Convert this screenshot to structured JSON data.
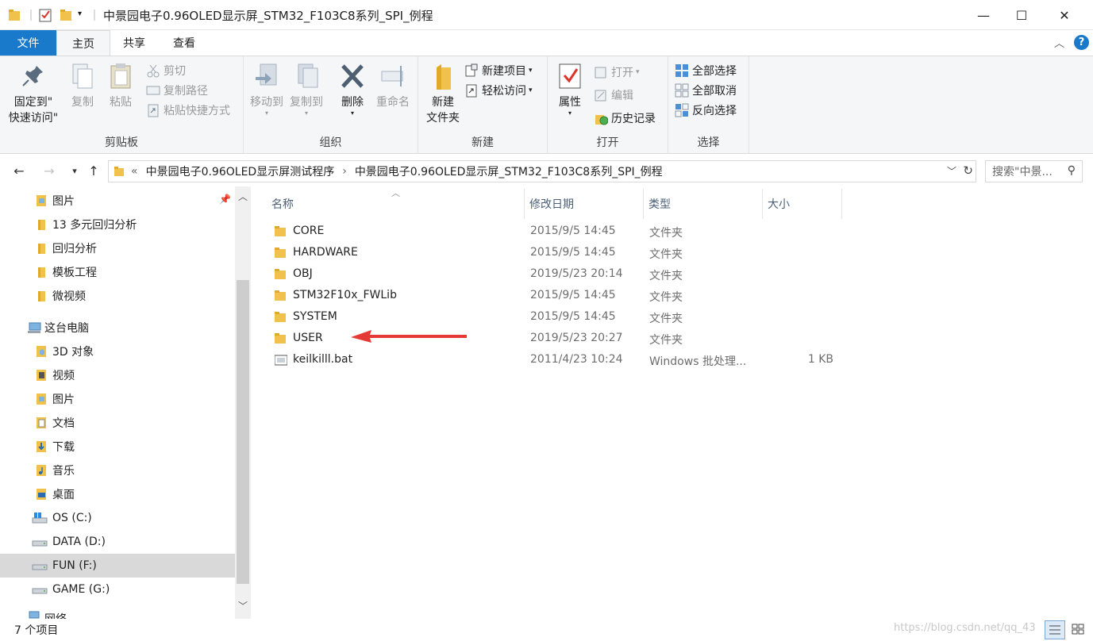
{
  "window": {
    "title": "中景园电子0.96OLED显示屏_STM32_F103C8系列_SPI_例程",
    "minimize": "—",
    "maximize": "☐",
    "close": "✕"
  },
  "ribbon_tabs": {
    "file": "文件",
    "home": "主页",
    "share": "共享",
    "view": "查看"
  },
  "ribbon": {
    "clipboard": {
      "label": "剪贴板",
      "pin_line1": "固定到\"",
      "pin_line2": "快速访问\"",
      "copy": "复制",
      "paste": "粘贴",
      "cut": "剪切",
      "copy_path": "复制路径",
      "paste_shortcut": "粘贴快捷方式"
    },
    "organize": {
      "label": "组织",
      "move_to": "移动到",
      "copy_to": "复制到",
      "delete": "删除",
      "rename": "重命名"
    },
    "new": {
      "label": "新建",
      "new_folder_line1": "新建",
      "new_folder_line2": "文件夹",
      "new_item": "新建项目",
      "easy_access": "轻松访问"
    },
    "open": {
      "label": "打开",
      "properties": "属性",
      "open": "打开",
      "edit": "编辑",
      "history": "历史记录"
    },
    "select": {
      "label": "选择",
      "select_all": "全部选择",
      "select_none": "全部取消",
      "invert": "反向选择"
    }
  },
  "address": {
    "prefix": "«",
    "segment1": "中景园电子0.96OLED显示屏测试程序",
    "separator": "›",
    "segment2": "中景园电子0.96OLED显示屏_STM32_F103C8系列_SPI_例程",
    "search_placeholder": "搜索\"中景..."
  },
  "nav_pane": {
    "items": [
      {
        "label": "图片",
        "pinned": true
      },
      {
        "label": "13 多元回归分析"
      },
      {
        "label": "回归分析"
      },
      {
        "label": "模板工程"
      },
      {
        "label": "微视频"
      },
      {
        "label": "这台电脑"
      },
      {
        "label": "3D 对象"
      },
      {
        "label": "视频"
      },
      {
        "label": "图片"
      },
      {
        "label": "文档"
      },
      {
        "label": "下载"
      },
      {
        "label": "音乐"
      },
      {
        "label": "桌面"
      },
      {
        "label": "OS (C:)"
      },
      {
        "label": "DATA (D:)"
      },
      {
        "label": "FUN (F:)",
        "selected": true
      },
      {
        "label": "GAME (G:)"
      },
      {
        "label": "网络"
      }
    ]
  },
  "columns": {
    "name": "名称",
    "date": "修改日期",
    "type": "类型",
    "size": "大小"
  },
  "files": [
    {
      "name": "CORE",
      "date": "2015/9/5 14:45",
      "type": "文件夹",
      "size": ""
    },
    {
      "name": "HARDWARE",
      "date": "2015/9/5 14:45",
      "type": "文件夹",
      "size": ""
    },
    {
      "name": "OBJ",
      "date": "2019/5/23 20:14",
      "type": "文件夹",
      "size": ""
    },
    {
      "name": "STM32F10x_FWLib",
      "date": "2015/9/5 14:45",
      "type": "文件夹",
      "size": ""
    },
    {
      "name": "SYSTEM",
      "date": "2015/9/5 14:45",
      "type": "文件夹",
      "size": ""
    },
    {
      "name": "USER",
      "date": "2019/5/23 20:27",
      "type": "文件夹",
      "size": ""
    },
    {
      "name": "keilkilll.bat",
      "date": "2011/4/23 10:24",
      "type": "Windows 批处理...",
      "size": "1 KB"
    }
  ],
  "status": {
    "count": "7 个项目",
    "watermark": "https://blog.csdn.net/qq_43"
  },
  "colors": {
    "file_tab": "#1979ca",
    "folder": "#f0c24b",
    "annotation_arrow": "#e53935",
    "selected_row": "#d9d9d9"
  }
}
